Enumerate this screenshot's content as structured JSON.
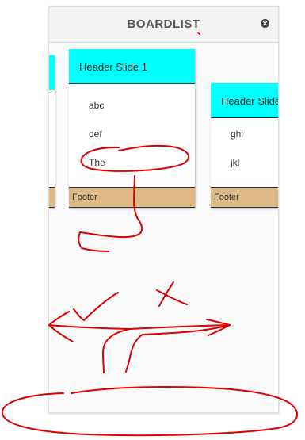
{
  "panel": {
    "title": "BOARDLIST",
    "close_icon": "close-circle-icon"
  },
  "slides": [
    {
      "header": "",
      "items": [],
      "footer": ""
    },
    {
      "header": "Header Slide 1",
      "items": [
        "abc",
        "def",
        "The"
      ],
      "footer": "Footer"
    },
    {
      "header": "Header Slide",
      "items": [
        "ghi",
        "jkl"
      ],
      "footer": "Footer"
    }
  ],
  "colors": {
    "card_header": "#00ffff",
    "card_footer": "#deb887",
    "annotation": "#e00000"
  }
}
